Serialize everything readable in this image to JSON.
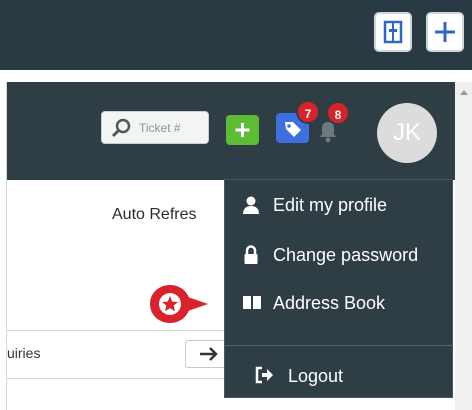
{
  "window": {
    "toolbar": {
      "panel_icon": "split-panel-icon",
      "add_icon": "plus-icon"
    }
  },
  "header": {
    "search": {
      "placeholder": "Ticket #",
      "icon": "search-icon"
    },
    "add_icon": "plus-icon",
    "tags": {
      "icon": "tag-icon",
      "count": "7"
    },
    "notifications": {
      "icon": "bell-icon",
      "count": "8"
    },
    "avatar_initials": "JK"
  },
  "content": {
    "auto_refresh": "Auto Refres",
    "row_label": "uiries",
    "row_action_icon": "arrow-right-icon"
  },
  "user_menu": {
    "items": [
      {
        "label": "Edit my profile",
        "icon": "user-icon"
      },
      {
        "label": "Change password",
        "icon": "lock-icon"
      },
      {
        "label": "Address Book",
        "icon": "book-icon"
      },
      {
        "label": "Logout",
        "icon": "logout-icon"
      }
    ]
  },
  "colors": {
    "topbar": "#2a3a42",
    "header": "#2f3d44",
    "add_green": "#5dbb35",
    "tag_blue": "#3d6fe0",
    "badge_red": "#d9232a",
    "pin_red": "#d9232a"
  }
}
